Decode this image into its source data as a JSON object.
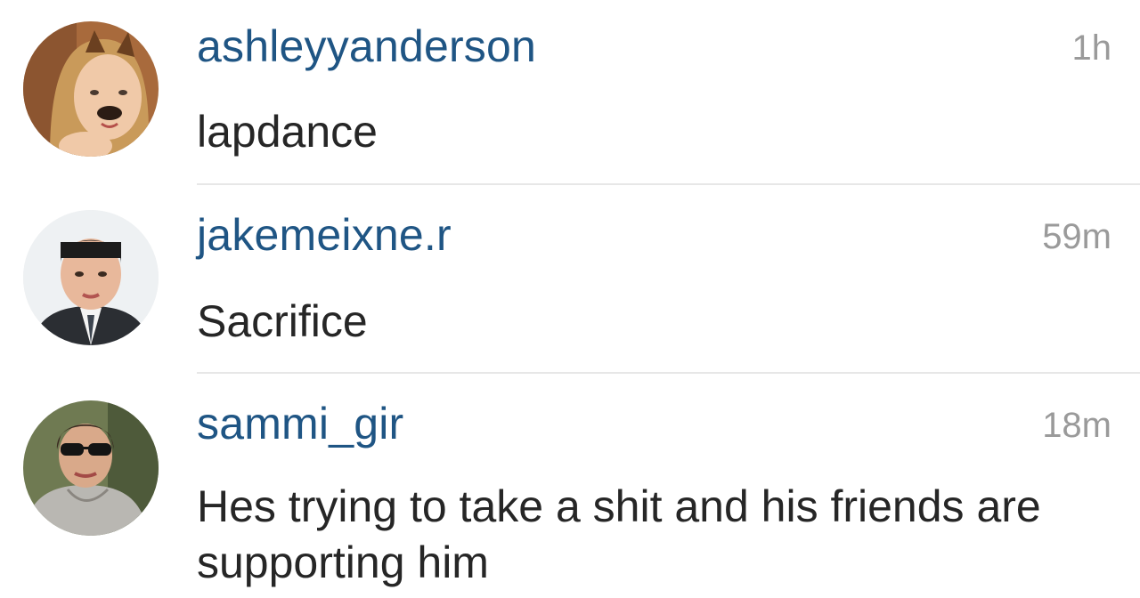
{
  "comments": [
    {
      "username": "ashleyyanderson",
      "time": "1h",
      "text": "lapdance",
      "avatar_icon": "avatar-photo-girl-dog-filter"
    },
    {
      "username": "jakemeixne.r",
      "time": "59m",
      "text": "Sacrifice",
      "avatar_icon": "avatar-photo-man-suit"
    },
    {
      "username": "sammi_gir",
      "time": "18m",
      "text": "Hes trying to take a shit and his friends are supporting him",
      "avatar_icon": "avatar-photo-girl-sunglasses"
    }
  ],
  "colors": {
    "username": "#1f5584",
    "timestamp": "#9a9a9a",
    "text": "#262626",
    "divider": "#e7e7e7"
  }
}
